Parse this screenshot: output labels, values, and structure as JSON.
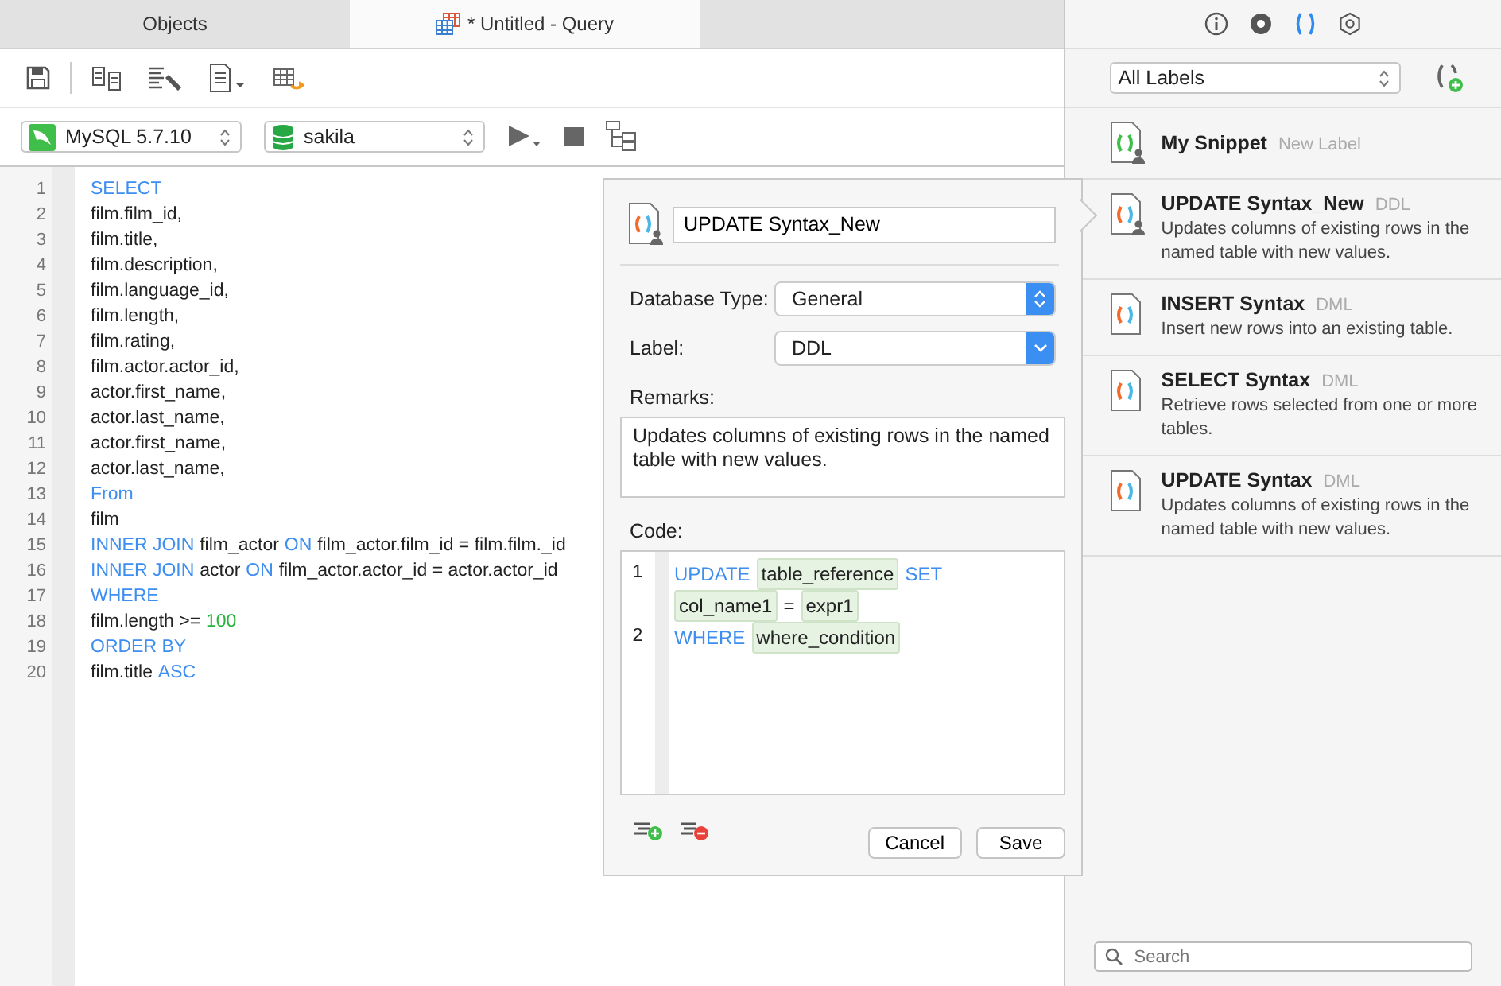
{
  "tabs": [
    {
      "label": "Objects",
      "selected": false
    },
    {
      "label": "* Untitled - Query",
      "selected": true
    }
  ],
  "connection": {
    "value": "MySQL 5.7.10"
  },
  "database": {
    "value": "sakila"
  },
  "editor": {
    "lines": [
      {
        "number": "1",
        "tokens": [
          {
            "text": "SELECT",
            "kind": "kw"
          }
        ]
      },
      {
        "number": "2",
        "tokens": [
          {
            "text": "film.film_id,",
            "kind": "id"
          }
        ]
      },
      {
        "number": "3",
        "tokens": [
          {
            "text": "film.title,",
            "kind": "id"
          }
        ]
      },
      {
        "number": "4",
        "tokens": [
          {
            "text": "film.description,",
            "kind": "id"
          }
        ]
      },
      {
        "number": "5",
        "tokens": [
          {
            "text": "film.language_id,",
            "kind": "id"
          }
        ]
      },
      {
        "number": "6",
        "tokens": [
          {
            "text": "film.length,",
            "kind": "id"
          }
        ]
      },
      {
        "number": "7",
        "tokens": [
          {
            "text": "film.rating,",
            "kind": "id"
          }
        ]
      },
      {
        "number": "8",
        "tokens": [
          {
            "text": "film.actor.actor_id,",
            "kind": "id"
          }
        ]
      },
      {
        "number": "9",
        "tokens": [
          {
            "text": "actor.first_name,",
            "kind": "id"
          }
        ]
      },
      {
        "number": "10",
        "tokens": [
          {
            "text": "actor.last_name,",
            "kind": "id"
          }
        ]
      },
      {
        "number": "11",
        "tokens": [
          {
            "text": "actor.first_name,",
            "kind": "id"
          }
        ]
      },
      {
        "number": "12",
        "tokens": [
          {
            "text": "actor.last_name,",
            "kind": "id"
          }
        ]
      },
      {
        "number": "13",
        "tokens": [
          {
            "text": "From",
            "kind": "kw"
          }
        ]
      },
      {
        "number": "14",
        "tokens": [
          {
            "text": "film",
            "kind": "id"
          }
        ]
      },
      {
        "number": "15",
        "tokens": [
          {
            "text": "INNER JOIN",
            "kind": "kw"
          },
          {
            "text": "film_actor",
            "kind": "id"
          },
          {
            "text": "ON",
            "kind": "kw"
          },
          {
            "text": "film_actor.film_id = film.film._id",
            "kind": "id"
          }
        ]
      },
      {
        "number": "16",
        "tokens": [
          {
            "text": "INNER JOIN",
            "kind": "kw"
          },
          {
            "text": "actor",
            "kind": "id"
          },
          {
            "text": "ON",
            "kind": "kw"
          },
          {
            "text": "film_actor.actor_id = actor.actor_id",
            "kind": "id"
          }
        ]
      },
      {
        "number": "17",
        "tokens": [
          {
            "text": "WHERE",
            "kind": "kw"
          }
        ]
      },
      {
        "number": "18",
        "tokens": [
          {
            "text": "film.length >=",
            "kind": "id"
          },
          {
            "text": "100",
            "kind": "num"
          }
        ]
      },
      {
        "number": "19",
        "tokens": [
          {
            "text": "ORDER BY",
            "kind": "kw"
          }
        ]
      },
      {
        "number": "20",
        "tokens": [
          {
            "text": "film.title",
            "kind": "id"
          },
          {
            "text": "ASC",
            "kind": "kw"
          }
        ]
      }
    ]
  },
  "snippet_editor": {
    "name": "UPDATE Syntax_New",
    "fields": [
      {
        "label": "Database Type:",
        "value": "General",
        "kind": "stepper"
      },
      {
        "label": "Label:",
        "value": "DDL",
        "kind": "dropdown"
      }
    ],
    "remarks_label": "Remarks:",
    "remarks": "Updates columns of existing rows in the named table with new values.",
    "code_label": "Code:",
    "code_lines": [
      {
        "number": "1",
        "tokens": [
          {
            "text": "UPDATE",
            "kind": "kw"
          },
          {
            "text": "table_reference",
            "kind": "ph"
          },
          {
            "text": "SET",
            "kind": "kw"
          },
          {
            "text": "col_name1",
            "kind": "ph"
          },
          {
            "text": "=",
            "kind": "id"
          },
          {
            "text": "expr1",
            "kind": "ph"
          }
        ]
      },
      {
        "number": "2",
        "tokens": [
          {
            "text": "WHERE",
            "kind": "kw"
          },
          {
            "text": "where_condition",
            "kind": "ph"
          }
        ]
      }
    ],
    "buttons": [
      "Cancel",
      "Save"
    ]
  },
  "side_tabs": [
    {
      "kind": "info",
      "selected": false
    },
    {
      "kind": "eye",
      "selected": false
    },
    {
      "kind": "snippets",
      "selected": true
    },
    {
      "kind": "hexagon",
      "selected": false
    }
  ],
  "label_filter": {
    "value": "All Labels"
  },
  "snippets": [
    {
      "title": "My Snippet",
      "label": "New Label",
      "kind": "group"
    },
    {
      "title": "UPDATE Syntax_New",
      "label": "DDL",
      "description": "Updates columns of existing rows in the named table with new values.",
      "kind": "user"
    },
    {
      "title": "INSERT Syntax",
      "label": "DML",
      "description": "Insert new rows into an existing table.",
      "kind": "builtin"
    },
    {
      "title": "SELECT Syntax",
      "label": "DML",
      "description": "Retrieve rows selected from one or more tables.",
      "kind": "builtin"
    },
    {
      "title": "UPDATE Syntax",
      "label": "DML",
      "description": "Updates columns of existing rows in the named table with new values.",
      "kind": "builtin"
    }
  ],
  "search": {
    "placeholder": "Search"
  }
}
